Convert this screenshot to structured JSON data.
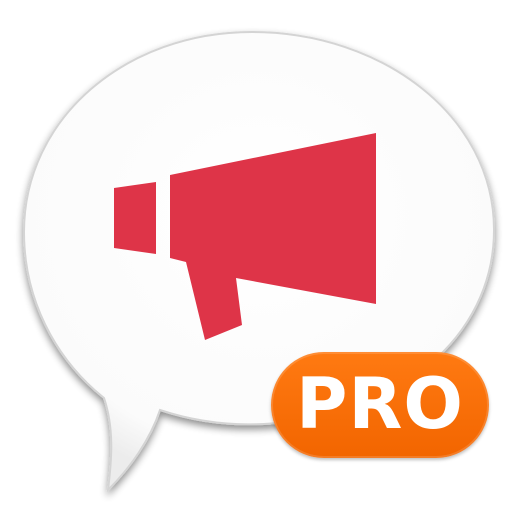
{
  "badge": {
    "label": "PRO"
  },
  "icons": {
    "bubble": "speech-bubble-icon",
    "megaphone": "megaphone-icon"
  },
  "colors": {
    "bubble_fill": "#ffffff",
    "bubble_shadow": "#b0b0b0",
    "megaphone": "#de3448",
    "badge_fill": "#f26a00",
    "badge_text": "#ffffff"
  }
}
